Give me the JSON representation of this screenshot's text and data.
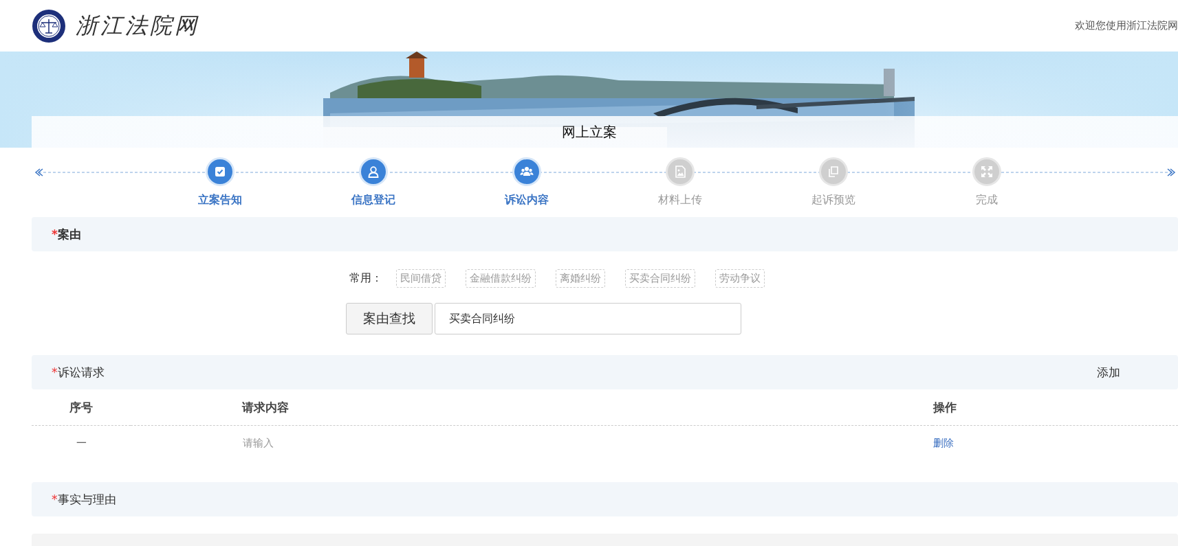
{
  "header": {
    "site_name": "浙江法院网",
    "welcome": "欢迎您使用浙江法院网"
  },
  "banner": {
    "title": "网上立案"
  },
  "steps": [
    {
      "label": "立案告知",
      "completed": true
    },
    {
      "label": "信息登记",
      "completed": true
    },
    {
      "label": "诉讼内容",
      "completed": true
    },
    {
      "label": "材料上传",
      "completed": false
    },
    {
      "label": "起诉预览",
      "completed": false
    },
    {
      "label": "完成",
      "completed": false
    }
  ],
  "cause": {
    "required_mark": "*",
    "title": "案由",
    "common_label": "常用：",
    "common_tags": [
      "民间借贷",
      "金融借款纠纷",
      "离婚纠纷",
      "买卖合同纠纷",
      "劳动争议"
    ],
    "search_button": "案由查找",
    "search_value": "买卖合同纠纷"
  },
  "claims": {
    "required_mark": "*",
    "title": "诉讼请求",
    "add_link": "添加",
    "columns": [
      "序号",
      "请求内容",
      "操作"
    ],
    "rows": [
      {
        "index": "一",
        "placeholder": "请输入",
        "action": "删除"
      }
    ]
  },
  "facts": {
    "required_mark": "*",
    "title": "事实与理由"
  }
}
